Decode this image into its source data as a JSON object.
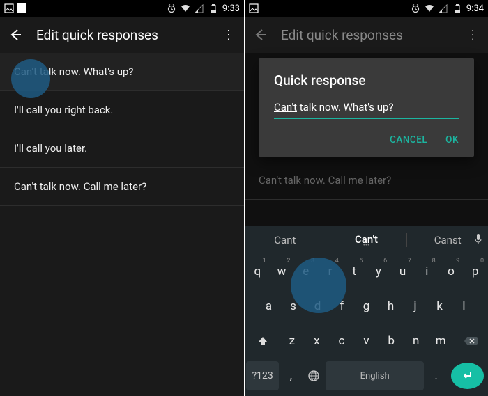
{
  "left": {
    "status": {
      "time": "9:33"
    },
    "toolbar": {
      "title": "Edit quick responses"
    },
    "items": [
      "Can't talk now. What's up?",
      "I'll call you right back.",
      "I'll call you later.",
      "Can't talk now. Call me later?"
    ]
  },
  "right": {
    "status": {
      "time": "9:34"
    },
    "toolbar": {
      "title": "Edit quick responses"
    },
    "dimItem": "Can't talk now. Call me later?",
    "dialog": {
      "title": "Quick response",
      "value_u": "Can't",
      "value_rest": " talk now. What's up?",
      "cancel": "CANCEL",
      "ok": "OK"
    },
    "suggestions": {
      "a": "Cant",
      "b": "Can't",
      "c": "Canst"
    },
    "keys": {
      "r1": [
        "q",
        "w",
        "e",
        "r",
        "t",
        "y",
        "u",
        "i",
        "o",
        "p"
      ],
      "r1n": [
        "1",
        "2",
        "3",
        "4",
        "5",
        "6",
        "7",
        "8",
        "9",
        "0"
      ],
      "r2": [
        "a",
        "s",
        "d",
        "f",
        "g",
        "h",
        "j",
        "k",
        "l"
      ],
      "r3": [
        "z",
        "x",
        "c",
        "v",
        "b",
        "n",
        "m"
      ],
      "sym": "?123",
      "comma": ",",
      "space": "English",
      "period": "."
    }
  }
}
